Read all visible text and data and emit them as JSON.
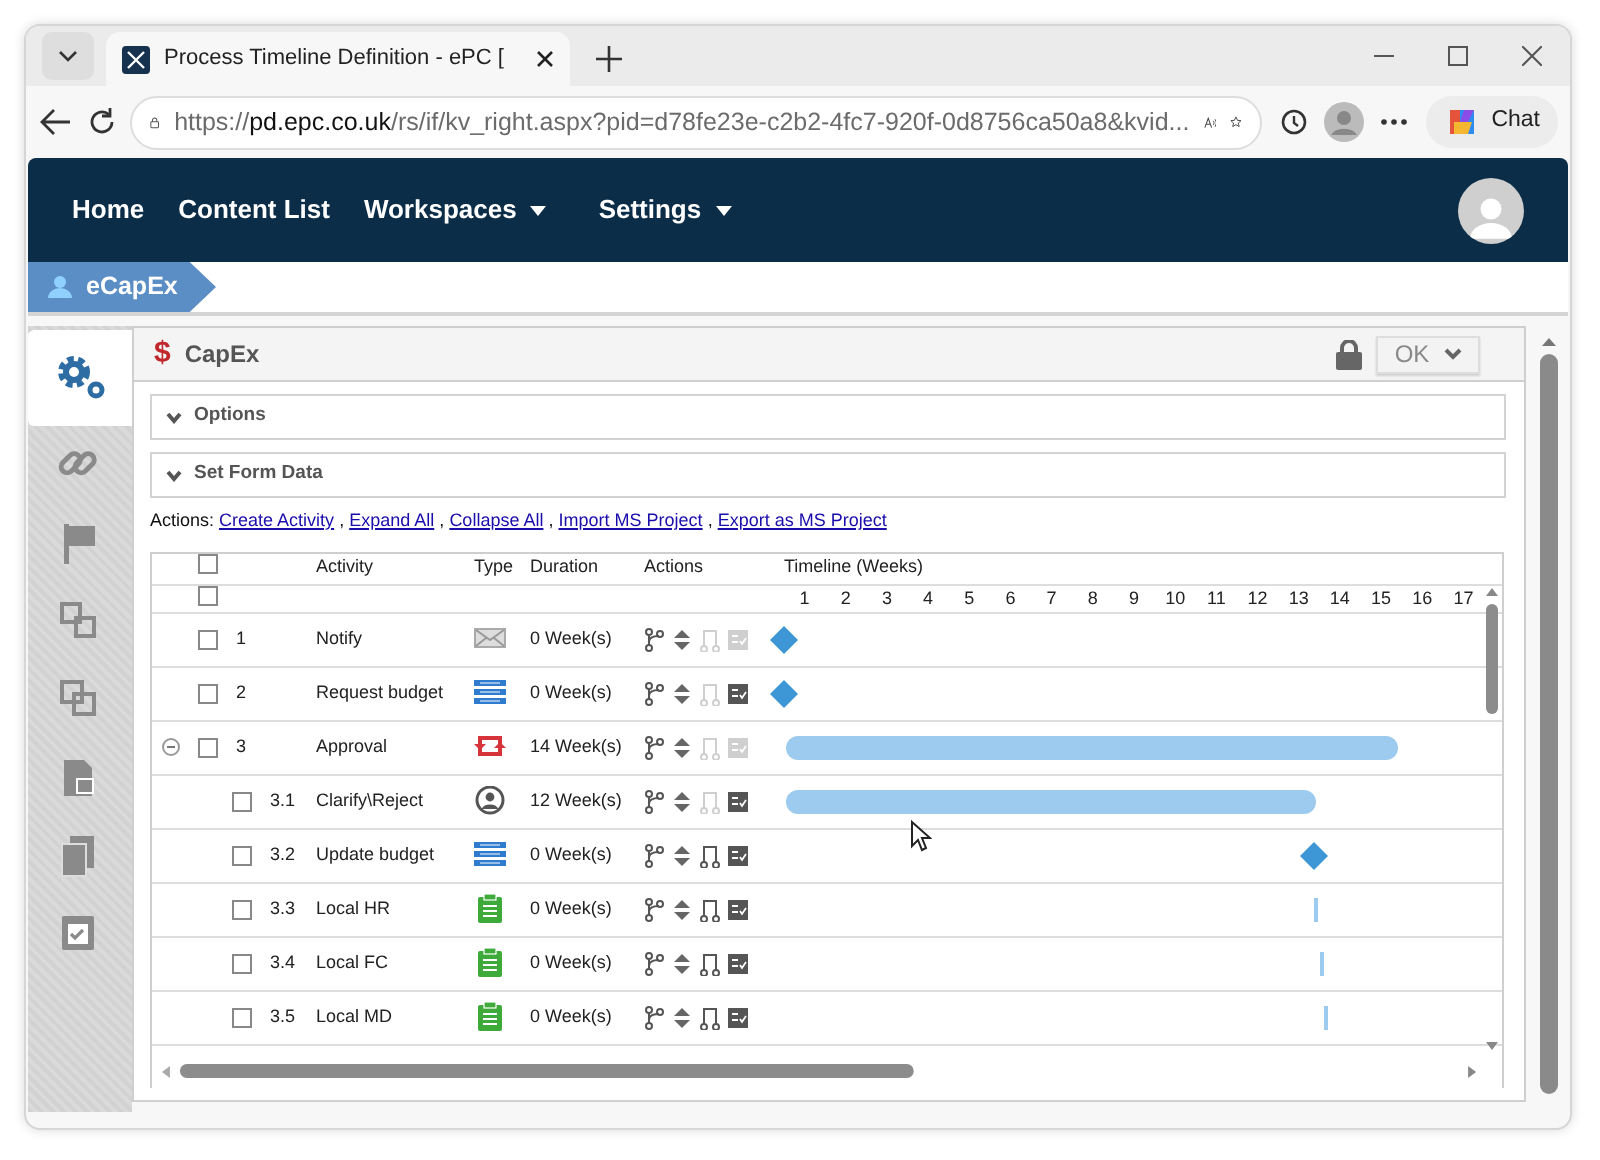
{
  "browser": {
    "tab_title": "Process Timeline Definition - ePC [",
    "address": {
      "scheme": "https://",
      "host": "pd.epc.co.uk",
      "path": "/rs/if/kv_right.aspx?pid=d78fe23e-c2b2-4fc7-920f-0d8756ca50a8&kvid..."
    },
    "chat": "Chat"
  },
  "navbar": {
    "items": [
      {
        "label": "Home",
        "dropdown": false
      },
      {
        "label": "Content List",
        "dropdown": false
      },
      {
        "label": "Workspaces",
        "dropdown": true
      },
      {
        "label": "Settings",
        "dropdown": true
      }
    ]
  },
  "breadcrumb": {
    "label": "eCapEx"
  },
  "sidebar": {
    "items": [
      {
        "kind": "gears",
        "selected": true
      },
      {
        "kind": "link",
        "selected": false
      },
      {
        "kind": "flag",
        "selected": false
      },
      {
        "kind": "squares",
        "selected": false
      },
      {
        "kind": "stack",
        "selected": false
      },
      {
        "kind": "lock",
        "selected": false
      },
      {
        "kind": "pages",
        "selected": false
      },
      {
        "kind": "check",
        "selected": false
      }
    ]
  },
  "panel": {
    "currency": "$",
    "title": "CapEx",
    "button": "OK",
    "locked": true
  },
  "sections": [
    {
      "label": "Options",
      "expanded": false
    },
    {
      "label": "Set Form Data",
      "expanded": false
    }
  ],
  "actions": {
    "label": "Actions:",
    "links": [
      "Create Activity",
      "Expand All",
      "Collapse All",
      "Import MS Project",
      "Export as MS Project"
    ],
    "separators": [
      ",",
      ",",
      ",",
      ","
    ]
  },
  "table": {
    "columns": [
      "Activity",
      "Type",
      "Duration",
      "Actions"
    ],
    "timeline_label": "Timeline (Weeks)",
    "weeks": [
      "1",
      "2",
      "3",
      "4",
      "5",
      "6",
      "7",
      "8",
      "9",
      "10",
      "11",
      "12",
      "13",
      "14",
      "15",
      "16",
      "17"
    ],
    "header_checked": false,
    "week_checked": false,
    "rows": [
      {
        "number": "1",
        "activity": "Notify",
        "type_icon": {
          "kind": "email"
        },
        "duration": "0 Week(s)",
        "checked": false,
        "timeline": {
          "kind": "diamond"
        },
        "actions": [
          {
            "kind": "branch",
            "disabled": false
          },
          {
            "kind": "move",
            "disabled": false
          },
          {
            "kind": "connect",
            "disabled": true
          },
          {
            "kind": "form",
            "disabled": true
          }
        ]
      },
      {
        "number": "2",
        "activity": "Request budget",
        "type_icon": {
          "kind": "list"
        },
        "duration": "0 Week(s)",
        "checked": false,
        "timeline": {
          "kind": "diamond"
        },
        "actions": [
          {
            "kind": "branch",
            "disabled": false
          },
          {
            "kind": "move",
            "disabled": false
          },
          {
            "kind": "connect",
            "disabled": true
          },
          {
            "kind": "form",
            "disabled": false
          }
        ]
      },
      {
        "number": "3",
        "activity": "Approval",
        "type_icon": {
          "kind": "loop"
        },
        "duration": "14 Week(s)",
        "checked": false,
        "expanded": true,
        "timeline": {
          "kind": "bar",
          "level": 0.874
        },
        "actions": [
          {
            "kind": "branch",
            "disabled": false
          },
          {
            "kind": "move",
            "disabled": false
          },
          {
            "kind": "connect",
            "disabled": true
          },
          {
            "kind": "form",
            "disabled": true
          }
        ],
        "children": [
          {
            "number": "3.1",
            "activity": "Clarify\\Reject",
            "type_icon": {
              "kind": "user"
            },
            "duration": "12 Week(s)",
            "checked": false,
            "timeline": {
              "kind": "bar",
              "level": 0.757
            },
            "actions": [
              {
                "kind": "branch",
                "disabled": false
              },
              {
                "kind": "move",
                "disabled": false
              },
              {
                "kind": "connect",
                "disabled": true
              },
              {
                "kind": "form",
                "disabled": false
              }
            ]
          },
          {
            "number": "3.2",
            "activity": "Update budget",
            "type_icon": {
              "kind": "list"
            },
            "duration": "0 Week(s)",
            "checked": false,
            "timeline": {
              "kind": "diamond"
            },
            "actions": [
              {
                "kind": "branch",
                "disabled": false
              },
              {
                "kind": "move",
                "disabled": false
              },
              {
                "kind": "connect",
                "disabled": false
              },
              {
                "kind": "form",
                "disabled": false
              }
            ]
          },
          {
            "number": "3.3",
            "activity": "Local HR",
            "type_icon": {
              "kind": "clipboard"
            },
            "duration": "0 Week(s)",
            "checked": false,
            "timeline": {
              "kind": "line"
            },
            "actions": [
              {
                "kind": "branch",
                "disabled": false
              },
              {
                "kind": "move",
                "disabled": false
              },
              {
                "kind": "connect",
                "disabled": false
              },
              {
                "kind": "form",
                "disabled": false
              }
            ]
          },
          {
            "number": "3.4",
            "activity": "Local FC",
            "type_icon": {
              "kind": "clipboard"
            },
            "duration": "0 Week(s)",
            "checked": false,
            "timeline": {
              "kind": "line"
            },
            "actions": [
              {
                "kind": "branch",
                "disabled": false
              },
              {
                "kind": "move",
                "disabled": false
              },
              {
                "kind": "connect",
                "disabled": false
              },
              {
                "kind": "form",
                "disabled": false
              }
            ]
          },
          {
            "number": "3.5",
            "activity": "Local MD",
            "type_icon": {
              "kind": "clipboard"
            },
            "duration": "0 Week(s)",
            "checked": false,
            "timeline": {
              "kind": "line"
            },
            "actions": [
              {
                "kind": "branch",
                "disabled": false
              },
              {
                "kind": "move",
                "disabled": false
              },
              {
                "kind": "connect",
                "disabled": false
              },
              {
                "kind": "form",
                "disabled": false
              }
            ]
          }
        ]
      }
    ]
  }
}
